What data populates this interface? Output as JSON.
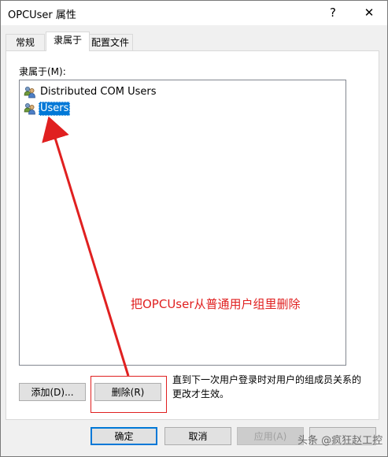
{
  "window": {
    "title": "OPCUser 属性",
    "help_glyph": "?",
    "close_glyph": "✕"
  },
  "tabs": [
    {
      "label": "常规"
    },
    {
      "label": "隶属于"
    },
    {
      "label": "配置文件"
    }
  ],
  "member_of": {
    "label": "隶属于(M):",
    "items": [
      {
        "name": "Distributed COM Users",
        "icon": "group-icon"
      },
      {
        "name": "Users",
        "icon": "group-icon",
        "selected": true
      }
    ]
  },
  "buttons": {
    "add": "添加(D)...",
    "remove": "删除(R)",
    "ok": "确定",
    "cancel": "取消",
    "apply": "应用(A)"
  },
  "note": "直到下一次用户登录时对用户的组成员关系的更改才生效。",
  "annotation": {
    "text": "把OPCUser从普通用户组里删除",
    "color": "#e02020"
  },
  "watermark": "头条 @疯狂赵工控"
}
